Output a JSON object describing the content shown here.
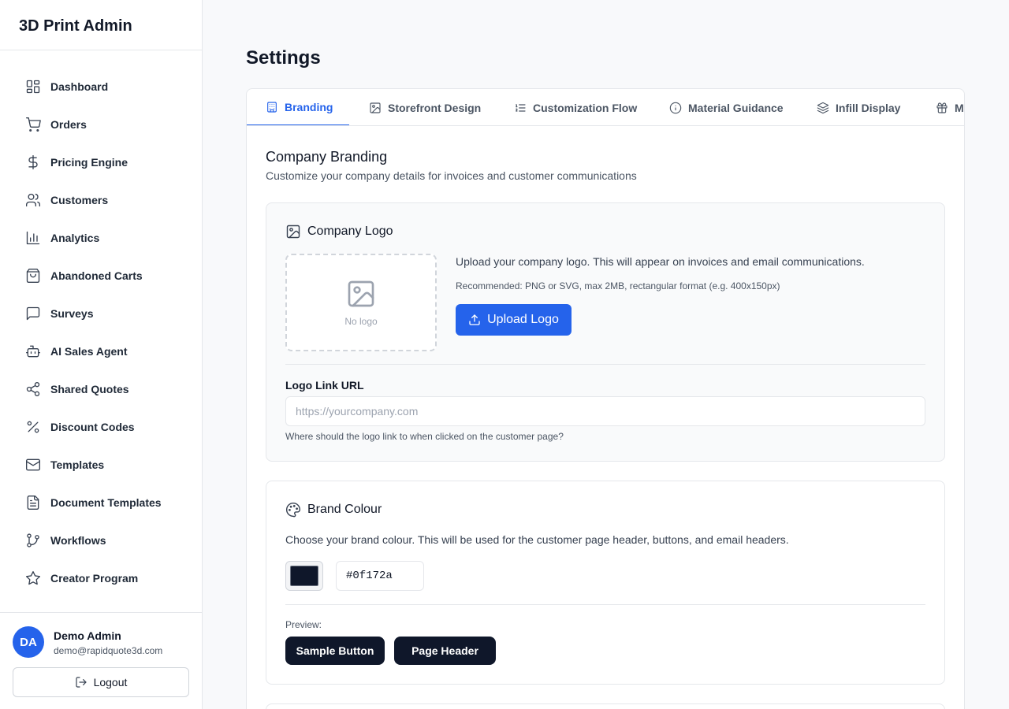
{
  "app": {
    "title": "3D Print Admin"
  },
  "sidebar": {
    "items": [
      {
        "label": "Dashboard",
        "icon": "layout-dashboard-icon"
      },
      {
        "label": "Orders",
        "icon": "shopping-cart-icon"
      },
      {
        "label": "Pricing Engine",
        "icon": "dollar-sign-icon"
      },
      {
        "label": "Customers",
        "icon": "users-icon"
      },
      {
        "label": "Analytics",
        "icon": "bar-chart-icon"
      },
      {
        "label": "Abandoned Carts",
        "icon": "shopping-bag-icon"
      },
      {
        "label": "Surveys",
        "icon": "message-square-icon"
      },
      {
        "label": "AI Sales Agent",
        "icon": "bot-icon"
      },
      {
        "label": "Shared Quotes",
        "icon": "share-icon"
      },
      {
        "label": "Discount Codes",
        "icon": "percent-icon"
      },
      {
        "label": "Templates",
        "icon": "mail-icon"
      },
      {
        "label": "Document Templates",
        "icon": "file-text-icon"
      },
      {
        "label": "Workflows",
        "icon": "git-branch-icon"
      },
      {
        "label": "Creator Program",
        "icon": "star-icon"
      }
    ]
  },
  "user": {
    "initials": "DA",
    "name": "Demo Admin",
    "email": "demo@rapidquote3d.com",
    "logout_label": "Logout"
  },
  "page": {
    "title": "Settings"
  },
  "tabs": [
    {
      "label": "Branding",
      "icon": "building-icon",
      "active": true
    },
    {
      "label": "Storefront Design",
      "icon": "image-icon",
      "active": false
    },
    {
      "label": "Customization Flow",
      "icon": "list-ordered-icon",
      "active": false
    },
    {
      "label": "Material Guidance",
      "icon": "info-icon",
      "active": false
    },
    {
      "label": "Infill Display",
      "icon": "layers-icon",
      "active": false
    },
    {
      "label": "M",
      "icon": "gift-icon",
      "active": false
    }
  ],
  "branding": {
    "title": "Company Branding",
    "subtitle": "Customize your company details for invoices and customer communications",
    "logo": {
      "title": "Company Logo",
      "no_logo": "No logo",
      "description": "Upload your company logo. This will appear on invoices and email communications.",
      "recommendation": "Recommended: PNG or SVG, max 2MB, rectangular format (e.g. 400x150px)",
      "upload_label": "Upload Logo",
      "link_label": "Logo Link URL",
      "link_placeholder": "https://yourcompany.com",
      "link_value": "",
      "link_help": "Where should the logo link to when clicked on the customer page?"
    },
    "colour": {
      "title": "Brand Colour",
      "description": "Choose your brand colour. This will be used for the customer page header, buttons, and email headers.",
      "hex": "#0f172a",
      "preview_label": "Preview:",
      "sample_button": "Sample Button",
      "page_header": "Page Header"
    }
  },
  "colors": {
    "accent": "#2563eb",
    "brand": "#0f172a"
  }
}
